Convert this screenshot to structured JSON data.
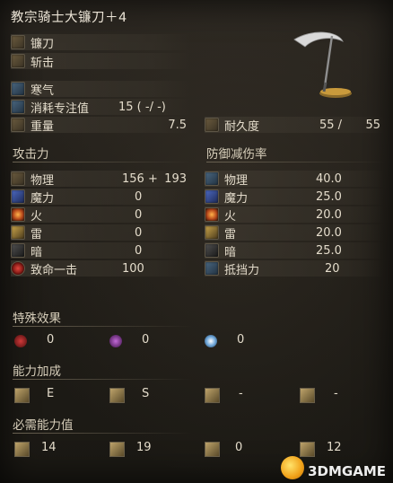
{
  "title": "教宗骑士大镰刀＋4",
  "weapon_type": "镰刀",
  "attack_type": "斩击",
  "infusion": "寒气",
  "fp_cost_label": "消耗专注值",
  "fp_cost_value": "15 (   -/   -)",
  "weight_label": "重量",
  "weight_value": "7.5",
  "durability_label": "耐久度",
  "durability_value": "55 /",
  "durability_max": "55",
  "attack_section": "攻击力",
  "defense_section": "防御减伤率",
  "attack": [
    {
      "label": "物理",
      "value": "156 +",
      "extra": "193",
      "icon": "physical-icon"
    },
    {
      "label": "魔力",
      "value": "0",
      "extra": "",
      "icon": "magic-icon"
    },
    {
      "label": "火",
      "value": "0",
      "extra": "",
      "icon": "fire-icon"
    },
    {
      "label": "雷",
      "value": "0",
      "extra": "",
      "icon": "lightning-icon"
    },
    {
      "label": "暗",
      "value": "0",
      "extra": "",
      "icon": "dark-icon"
    },
    {
      "label": "致命一击",
      "value": "100",
      "extra": "",
      "icon": "critical-icon"
    }
  ],
  "defense": [
    {
      "label": "物理",
      "value": "40.0",
      "icon": "physical-defense-icon"
    },
    {
      "label": "魔力",
      "value": "25.0",
      "icon": "magic-defense-icon"
    },
    {
      "label": "火",
      "value": "20.0",
      "icon": "fire-defense-icon"
    },
    {
      "label": "雷",
      "value": "20.0",
      "icon": "lightning-defense-icon"
    },
    {
      "label": "暗",
      "value": "25.0",
      "icon": "dark-defense-icon"
    },
    {
      "label": "抵挡力",
      "value": "20",
      "icon": "stability-icon"
    }
  ],
  "special_section": "特殊效果",
  "effects": [
    {
      "value": "0",
      "icon": "bleed-icon"
    },
    {
      "value": "0",
      "icon": "poison-icon"
    },
    {
      "value": "0",
      "icon": "frost-icon"
    }
  ],
  "scaling_section": "能力加成",
  "scaling": [
    {
      "value": "E",
      "icon": "strength-icon"
    },
    {
      "value": "S",
      "icon": "dexterity-icon"
    },
    {
      "value": "-",
      "icon": "intelligence-icon"
    },
    {
      "value": "-",
      "icon": "faith-icon"
    }
  ],
  "requirement_section": "必需能力值",
  "requirements": [
    {
      "value": "14",
      "icon": "strength-req-icon"
    },
    {
      "value": "19",
      "icon": "dexterity-req-icon"
    },
    {
      "value": "0",
      "icon": "intelligence-req-icon"
    },
    {
      "value": "12",
      "icon": "faith-req-icon"
    }
  ],
  "watermark": "3DMGAME"
}
